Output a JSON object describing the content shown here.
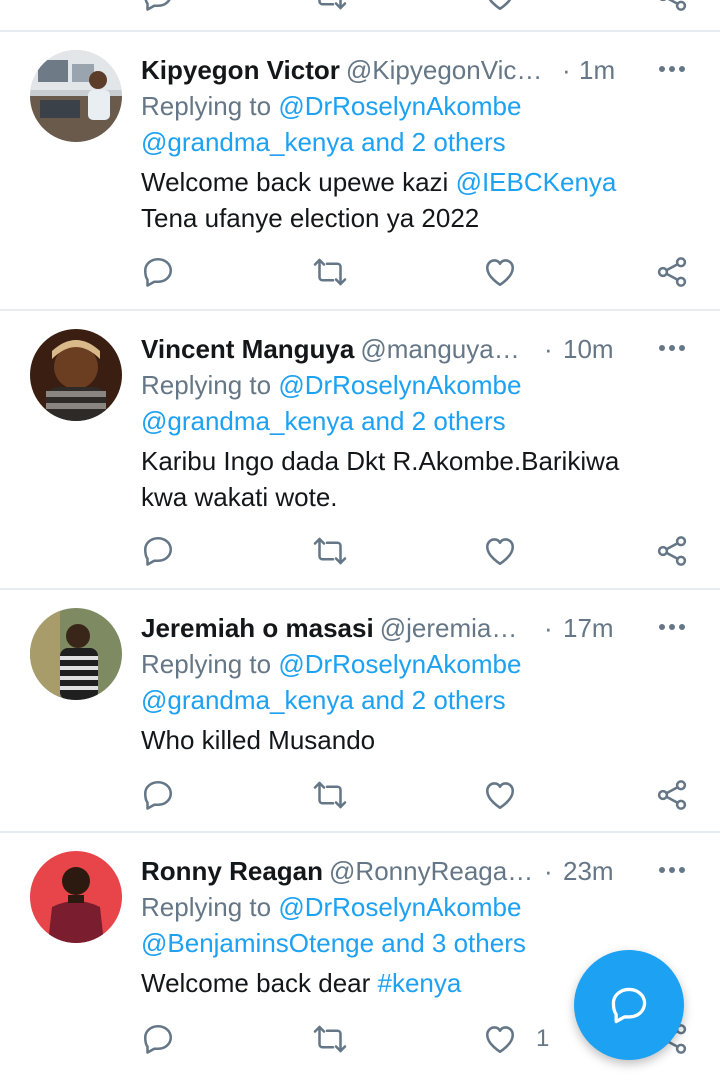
{
  "tweets": [
    {
      "name": "Kipyegon Victor",
      "handle": "@KipyegonVic…",
      "dot": "·",
      "time": "1m",
      "replying_prefix": "Replying to",
      "replying_user": "@DrRoselynAkombe",
      "replying_line2": "@grandma_kenya and 2 others",
      "text_line1_plain": "Welcome back upewe kazi ",
      "text_line1_link": "@IEBCKenya",
      "text_line2": "Tena ufanye election ya 2022",
      "like_count": ""
    },
    {
      "name": "Vincent Manguya",
      "handle": "@manguya…",
      "dot": "·",
      "time": "10m",
      "replying_prefix": "Replying to",
      "replying_user": "@DrRoselynAkombe",
      "replying_line2": "@grandma_kenya and 2 others",
      "text_line1_plain": "Karibu Ingo dada Dkt R.Akombe.Barikiwa",
      "text_line1_link": "",
      "text_line2": "kwa wakati wote.",
      "like_count": ""
    },
    {
      "name": "Jeremiah o masasi",
      "handle": "@jeremia…",
      "dot": "·",
      "time": "17m",
      "replying_prefix": "Replying to",
      "replying_user": "@DrRoselynAkombe",
      "replying_line2": "@grandma_kenya and 2 others",
      "text_line1_plain": "Who killed Musando",
      "text_line1_link": "",
      "text_line2": "",
      "like_count": ""
    },
    {
      "name": "Ronny Reagan",
      "handle": "@RonnyReaga…",
      "dot": "·",
      "time": "23m",
      "replying_prefix": "Replying to",
      "replying_user": "@DrRoselynAkombe",
      "replying_line2": "@BenjaminsOtenge and 3 others",
      "text_line1_plain": "Welcome back dear ",
      "text_line1_link": "#kenya",
      "text_line2": "",
      "like_count": "1"
    }
  ],
  "icons": {
    "reply": "reply-icon",
    "retweet": "retweet-icon",
    "like": "heart-icon",
    "share": "share-icon",
    "more": "more-options-icon",
    "compose": "compose-reply-icon"
  },
  "colors": {
    "link": "#1da1f2",
    "secondary_text": "#657786",
    "divider": "#e6ecf0",
    "fab": "#1da1f2"
  }
}
